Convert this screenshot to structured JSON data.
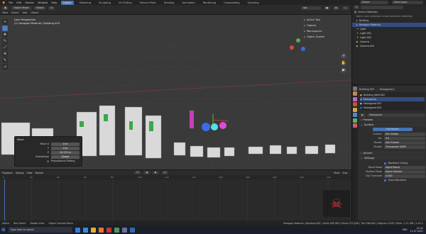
{
  "menubar": {
    "menus": [
      "File",
      "Edit",
      "Render",
      "Window",
      "Help"
    ],
    "workspaces": [
      "Layout",
      "Modeling",
      "Sculpting",
      "UV Editing",
      "Texture Paint",
      "Shading",
      "Animation",
      "Rendering",
      "Compositing",
      "Scripting"
    ],
    "scene": "Scene",
    "view_layer": "View Layer"
  },
  "toolheader": {
    "mode": "Object Mode",
    "transform": "Global",
    "view_menu": [
      "View",
      "Select",
      "Add",
      "Object"
    ],
    "search": "dgt"
  },
  "viewport": {
    "title": "User Perspective",
    "collection": "(1) Hexagon Material | Building 003",
    "side_tabs": [
      "Active Tool",
      "Objects",
      "Workspaces",
      "Object Scatter"
    ]
  },
  "operator_panel": {
    "title": "Move",
    "rows": [
      {
        "label": "Move X",
        "value": "0 m"
      },
      {
        "label": "Y",
        "value": "0 m"
      },
      {
        "label": "Z",
        "value": "15.175 m"
      },
      {
        "label": "Orientation",
        "value": "Global"
      }
    ],
    "proportional": "Proportional Editing"
  },
  "timeline": {
    "menus": [
      "Playback",
      "Keying",
      "View",
      "Marker"
    ],
    "frame_start": "Start",
    "frame_end": "End",
    "ticks": [
      "0",
      "20",
      "40",
      "60",
      "80",
      "100",
      "120",
      "140",
      "160",
      "180",
      "200",
      "220",
      "240"
    ]
  },
  "outliner": {
    "search_placeholder": "",
    "items": [
      {
        "label": "Scene Collection",
        "selected": false
      },
      {
        "label": "Add a new collection inside selected collection",
        "selected": false
      },
      {
        "label": "Building",
        "selected": false
      },
      {
        "label": "Hexagon Material",
        "selected": true
      },
      {
        "label": "Light",
        "selected": false
      },
      {
        "label": "Light.001",
        "selected": false
      },
      {
        "label": "Light.002",
        "selected": false
      },
      {
        "label": "Camera",
        "selected": false
      },
      {
        "label": "Camera.001",
        "selected": false
      }
    ]
  },
  "properties": {
    "object": "Building 003",
    "data": "Hexagonal.1",
    "material_slots": [
      "Building_Wall.002",
      "Hexagonal",
      "Hexagonal.001",
      "Hexagonal.002"
    ],
    "material_name": "Hexagonal",
    "sections": [
      "Preview",
      "Surface",
      "Volume",
      "Settings"
    ],
    "surface_rows": [
      {
        "label": "Surface",
        "value": "Mix Shader"
      },
      {
        "label": "Fac",
        "value": "0.5"
      },
      {
        "label": "Shader",
        "value": "Add Shader"
      },
      {
        "label": "Shader",
        "value": "Transparent BSDF"
      }
    ],
    "settings_rows": [
      {
        "label": "",
        "value": "Backface Culling"
      },
      {
        "label": "Blend Mode",
        "value": "Alpha Blend"
      },
      {
        "label": "Shadow Mode",
        "value": "Alpha Hashed"
      },
      {
        "label": "Clip Threshold",
        "value": "0.500"
      },
      {
        "label": "",
        "value": "Show Backface"
      }
    ],
    "use_nodes": "Use Nodes"
  },
  "statusbar": {
    "items": [
      "Select",
      "Box Select",
      "Rotate View",
      "Object Context Menu"
    ],
    "stats": "Hexagon Material | Building 003 | Verts:198,984 | Faces:373,028 | Tris:746,056 | Objects:1/109 | Mem: 1.22 GiB | 2.93.1"
  },
  "taskbar": {
    "search_placeholder": "Type here to search",
    "time": "07:42",
    "date": "11-07-2021",
    "lang": "ENG"
  },
  "colors": {
    "accent": "#4772b3",
    "viewport_bg": "#3a3a3a",
    "selection": "#334d80"
  }
}
